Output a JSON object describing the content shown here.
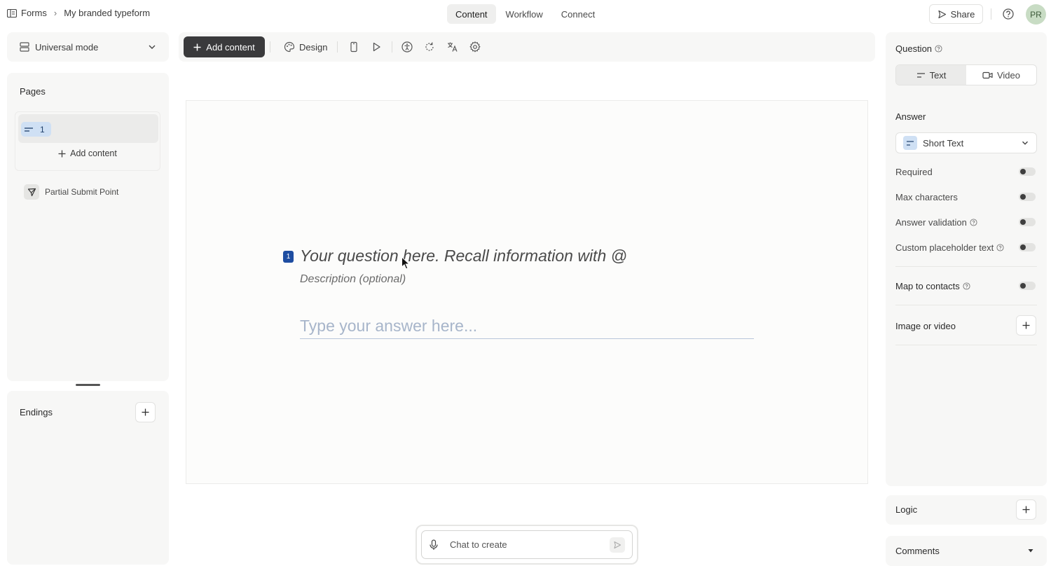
{
  "breadcrumb": {
    "root": "Forms",
    "separator": "›",
    "current": "My branded typeform"
  },
  "nav": {
    "tabs": [
      "Content",
      "Workflow",
      "Connect"
    ],
    "active": "Content"
  },
  "header": {
    "share_label": "Share",
    "avatar_initials": "PR"
  },
  "left": {
    "mode_label": "Universal mode",
    "pages_title": "Pages",
    "page_number": "1",
    "add_content_label": "Add content",
    "partial_submit_label": "Partial Submit Point",
    "endings_title": "Endings"
  },
  "toolbar": {
    "add_content_label": "Add content",
    "design_label": "Design",
    "icons": [
      "mobile-preview-icon",
      "play-icon",
      "accessibility-icon",
      "refresh-icon",
      "translate-icon",
      "settings-icon"
    ]
  },
  "canvas": {
    "question_number": "1",
    "question_placeholder": "Your question here. Recall information with @",
    "description_placeholder": "Description (optional)",
    "answer_placeholder": "Type your answer here..."
  },
  "chat": {
    "placeholder": "Chat to create"
  },
  "right": {
    "question_title": "Question",
    "question_types": [
      "Text",
      "Video"
    ],
    "active_question_type": "Text",
    "answer_title": "Answer",
    "answer_type": "Short Text",
    "options": [
      {
        "label": "Required",
        "enabled": false,
        "help": false
      },
      {
        "label": "Max characters",
        "enabled": false,
        "help": false
      },
      {
        "label": "Answer validation",
        "enabled": false,
        "help": true
      },
      {
        "label": "Custom placeholder text",
        "enabled": false,
        "help": true
      }
    ],
    "map_to_contacts": "Map to contacts",
    "map_to_contacts_enabled": false,
    "image_or_video": "Image or video",
    "logic": "Logic",
    "comments": "Comments"
  },
  "colors": {
    "accent_blue": "#1e4da1",
    "add_button_bg": "#3a3a3c",
    "avatar_bg": "#c8dcc4",
    "chip_bg": "#cfe0f4"
  }
}
